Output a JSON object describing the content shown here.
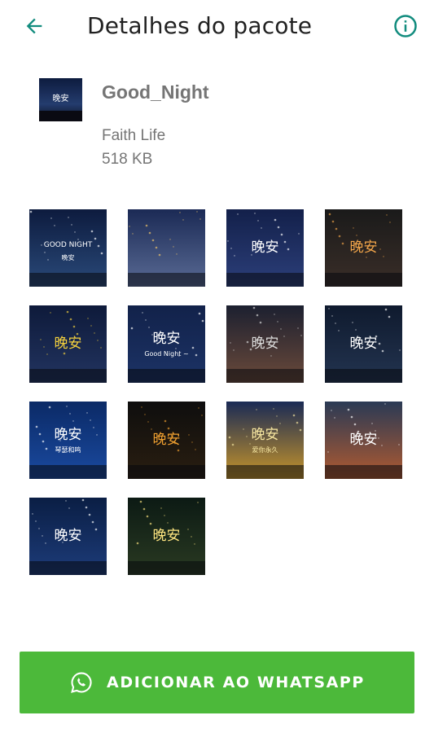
{
  "header": {
    "title": "Detalhes do pacote",
    "back_icon": "arrow-left-icon",
    "info_icon": "info-circle-icon",
    "accent": "#128c7e"
  },
  "pack": {
    "name": "Good_Night",
    "publisher": "Faith Life",
    "size": "518 KB",
    "icon_text": "晚安"
  },
  "stickers": [
    {
      "caption": "GOOD NIGHT",
      "sub": "晚安",
      "bg": [
        "#0d1b3e",
        "#2a4a7a"
      ],
      "accent": "#ffffff"
    },
    {
      "caption": "",
      "sub": "",
      "bg": [
        "#1b2a55",
        "#5a6b95"
      ],
      "accent": "#f4c86a"
    },
    {
      "caption": "晚安",
      "sub": "",
      "bg": [
        "#13204a",
        "#2c3f7a"
      ],
      "accent": "#ffffff"
    },
    {
      "caption": "晚安",
      "sub": "",
      "bg": [
        "#1a1a1a",
        "#3a2e28"
      ],
      "accent": "#f3a64a"
    },
    {
      "caption": "晚安",
      "sub": "",
      "bg": [
        "#0e1a3a",
        "#223460"
      ],
      "accent": "#f6d23d"
    },
    {
      "caption": "晚安",
      "sub": "Good Night ~",
      "bg": [
        "#12224a",
        "#1c3366"
      ],
      "accent": "#ffffff"
    },
    {
      "caption": "晚安",
      "sub": "",
      "bg": [
        "#1c2030",
        "#6b4a3a"
      ],
      "accent": "#dcdcdc"
    },
    {
      "caption": "晚安",
      "sub": "",
      "bg": [
        "#0f1a2e",
        "#233450"
      ],
      "accent": "#ffffff"
    },
    {
      "caption": "晚安",
      "sub": "琴瑟和鸣",
      "bg": [
        "#0b2a66",
        "#1a4aa0"
      ],
      "accent": "#ffffff"
    },
    {
      "caption": "晚安",
      "sub": "",
      "bg": [
        "#0e0e0e",
        "#2a1e10"
      ],
      "accent": "#f0a030"
    },
    {
      "caption": "晚安",
      "sub": "爱你永久",
      "bg": [
        "#1a2a55",
        "#c8962a"
      ],
      "accent": "#f6e6a0"
    },
    {
      "caption": "晚安",
      "sub": "",
      "bg": [
        "#2a3a55",
        "#b05a30"
      ],
      "accent": "#ffffff"
    },
    {
      "caption": "晚安",
      "sub": "",
      "bg": [
        "#0a1e44",
        "#1d3c7a"
      ],
      "accent": "#ffffff"
    },
    {
      "caption": "晚安",
      "sub": "",
      "bg": [
        "#0c1a14",
        "#2a3a22"
      ],
      "accent": "#ffe680"
    }
  ],
  "add_button": {
    "label": "ADICIONAR AO WHATSAPP",
    "icon": "whatsapp-icon",
    "color": "#4cb93a"
  }
}
